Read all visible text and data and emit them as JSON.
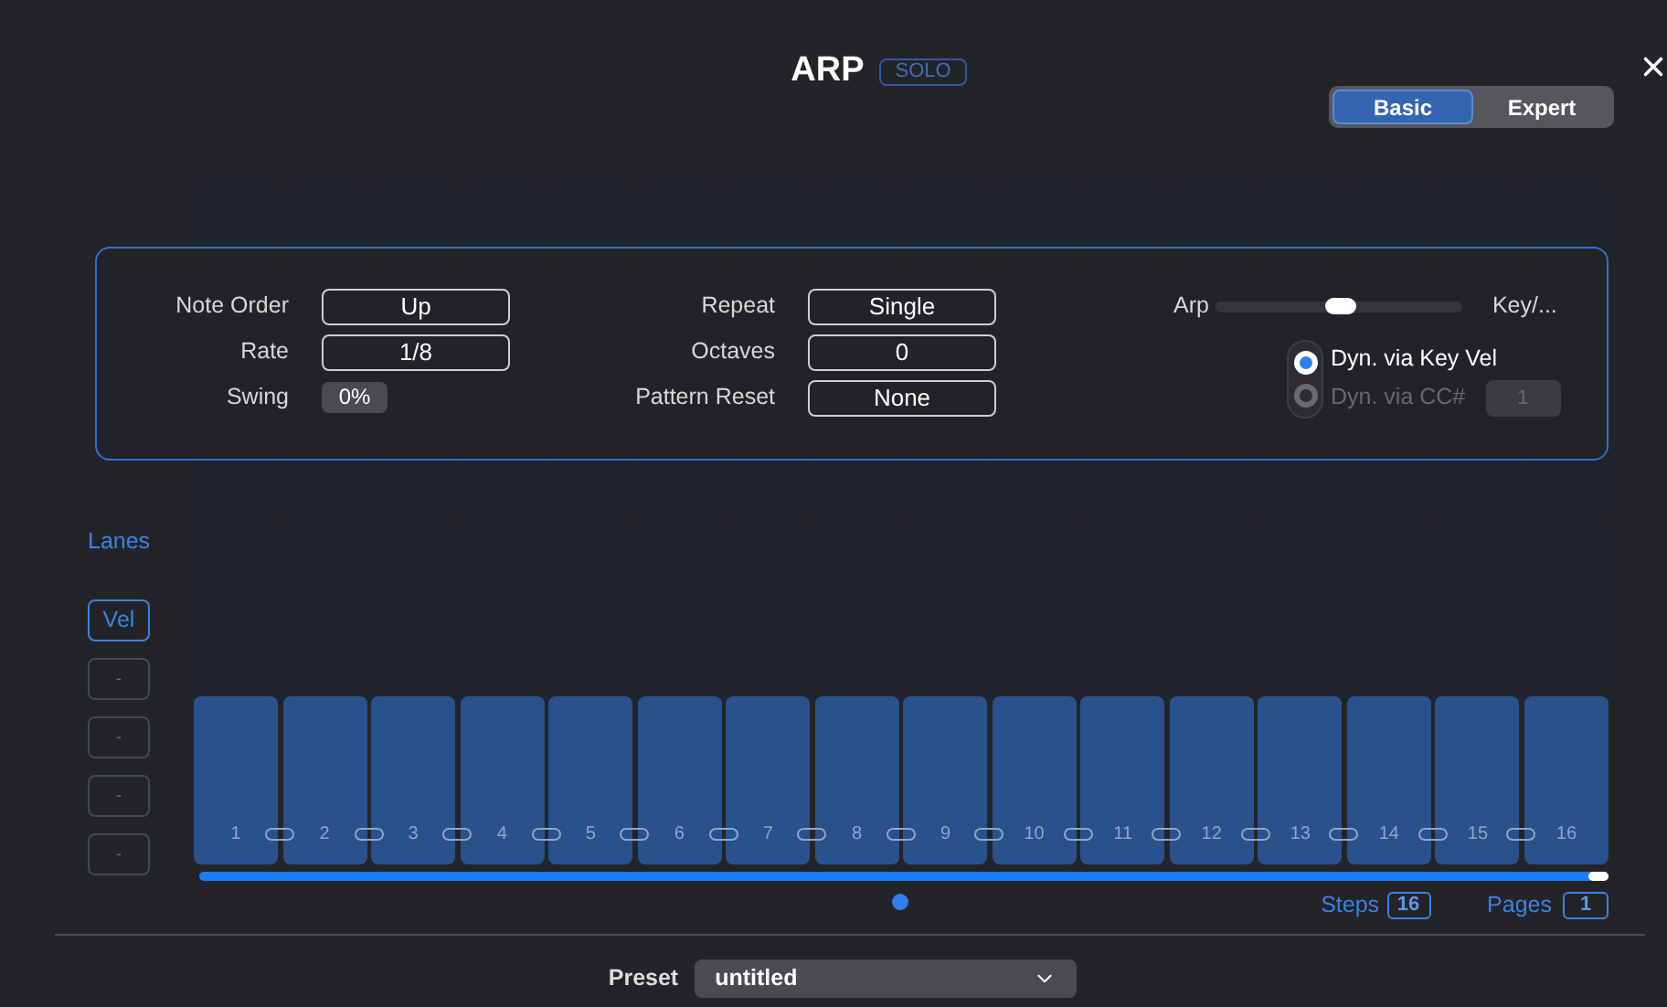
{
  "title": "ARP",
  "badge": "SOLO",
  "mode_tabs": [
    {
      "label": "Basic",
      "selected": true
    },
    {
      "label": "Expert",
      "selected": false
    }
  ],
  "settings": {
    "left": [
      {
        "label": "Note Order",
        "value": "Up",
        "kind": "select"
      },
      {
        "label": "Rate",
        "value": "1/8",
        "kind": "select"
      },
      {
        "label": "Swing",
        "value": "0%",
        "kind": "amount"
      }
    ],
    "middle": [
      {
        "label": "Repeat",
        "value": "Single",
        "kind": "select"
      },
      {
        "label": "Octaves",
        "value": "0",
        "kind": "select"
      },
      {
        "label": "Pattern Reset",
        "value": "None",
        "kind": "select"
      }
    ],
    "blend": {
      "left_label": "Arp",
      "right_label": "Key/...",
      "level": 0.5
    },
    "dynamics": [
      {
        "label": "Dyn. via Key Vel",
        "selected": true,
        "disabled": false
      },
      {
        "label": "Dyn. via CC#",
        "selected": false,
        "disabled": true,
        "value": "1"
      }
    ]
  },
  "lanes": {
    "title": "Lanes",
    "items": [
      {
        "label": "Vel",
        "selected": true
      },
      {
        "label": "-",
        "selected": false
      },
      {
        "label": "-",
        "selected": false
      },
      {
        "label": "-",
        "selected": false
      },
      {
        "label": "-",
        "selected": false
      }
    ]
  },
  "steps": [
    {
      "number": "1",
      "level": 0.5
    },
    {
      "number": "2",
      "level": 0.5
    },
    {
      "number": "3",
      "level": 0.5
    },
    {
      "number": "4",
      "level": 0.5
    },
    {
      "number": "5",
      "level": 0.5
    },
    {
      "number": "6",
      "level": 0.5
    },
    {
      "number": "7",
      "level": 0.5
    },
    {
      "number": "8",
      "level": 0.5
    },
    {
      "number": "9",
      "level": 0.5
    },
    {
      "number": "10",
      "level": 0.5
    },
    {
      "number": "11",
      "level": 0.5
    },
    {
      "number": "12",
      "level": 0.5
    },
    {
      "number": "13",
      "level": 0.5
    },
    {
      "number": "14",
      "level": 0.5
    },
    {
      "number": "15",
      "level": 0.5
    },
    {
      "number": "16",
      "level": 0.5
    }
  ],
  "range_bar": {
    "level": 1
  },
  "steps_count": {
    "label": "Steps",
    "value": "16"
  },
  "pages": {
    "label": "Pages",
    "value": "1"
  },
  "preset": {
    "label": "Preset",
    "value": "untitled"
  }
}
